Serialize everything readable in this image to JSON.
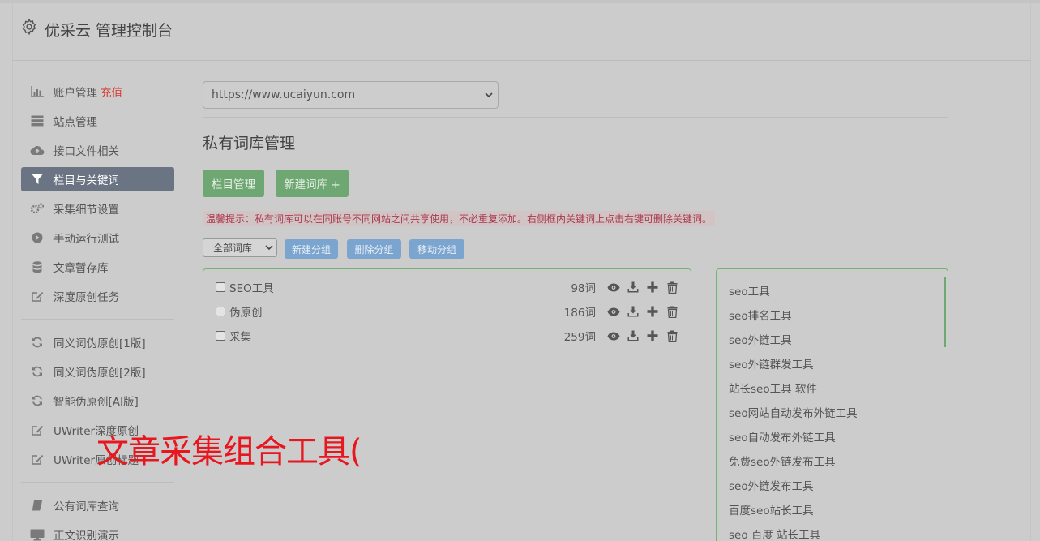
{
  "header": {
    "title": "优采云 管理控制台",
    "icon": "gear-icon"
  },
  "sidebar": {
    "items": [
      {
        "label": "账户管理",
        "extra": "充值",
        "icon": "bar-chart-icon"
      },
      {
        "label": "站点管理",
        "icon": "server-icon"
      },
      {
        "label": "接口文件相关",
        "icon": "cloud-upload-icon"
      },
      {
        "label": "栏目与关键词",
        "icon": "filter-icon",
        "active": true
      },
      {
        "label": "采集细节设置",
        "icon": "cogs-icon"
      },
      {
        "label": "手动运行测试",
        "icon": "play-circle-icon"
      },
      {
        "label": "文章暂存库",
        "icon": "database-icon"
      },
      {
        "label": "深度原创任务",
        "icon": "edit-icon"
      },
      {
        "label": "同义词伪原创[1版]",
        "icon": "refresh-icon"
      },
      {
        "label": "同义词伪原创[2版]",
        "icon": "refresh-icon"
      },
      {
        "label": "智能伪原创[AI版]",
        "icon": "refresh-icon"
      },
      {
        "label": "UWriter深度原创",
        "icon": "edit-icon"
      },
      {
        "label": "UWriter原创标题",
        "icon": "edit-icon"
      },
      {
        "label": "公有词库查询",
        "icon": "book-icon"
      },
      {
        "label": "正文识别演示",
        "icon": "monitor-icon"
      }
    ]
  },
  "main": {
    "site_select": "https://www.ucaiyun.com",
    "page_title": "私有词库管理",
    "buttons": {
      "column_manage": "栏目管理",
      "new_library": "新建词库 +"
    },
    "notice": "温馨提示：私有词库可以在同账号不同网站之间共享使用，不必重复添加。右侧框内关键词上点击右键可删除关键词。",
    "group_select": "全部词库",
    "group_buttons": {
      "new_group": "新建分组",
      "delete_group": "删除分组",
      "move_group": "移动分组"
    },
    "libraries": [
      {
        "name": "SEO工具",
        "count": "98词"
      },
      {
        "name": "伪原创",
        "count": "186词"
      },
      {
        "name": "采集",
        "count": "259词"
      }
    ],
    "keywords": [
      "seo工具",
      "seo排名工具",
      "seo外链工具",
      "seo外链群发工具",
      "站长seo工具 软件",
      "seo网站自动发布外链工具",
      "seo自动发布外链工具",
      "免费seo外链发布工具",
      "seo外链发布工具",
      "百度seo站长工具",
      "seo 百度 站长工具"
    ]
  },
  "overlay": {
    "watermark": "文章采集组合工具("
  },
  "colors": {
    "active_nav": "#6b7482",
    "green_button": "#6fa773",
    "blue_button": "#7ba4cf",
    "notice_text": "#a8394e",
    "watermark": "#e8161f",
    "recharge": "#d9302b"
  }
}
